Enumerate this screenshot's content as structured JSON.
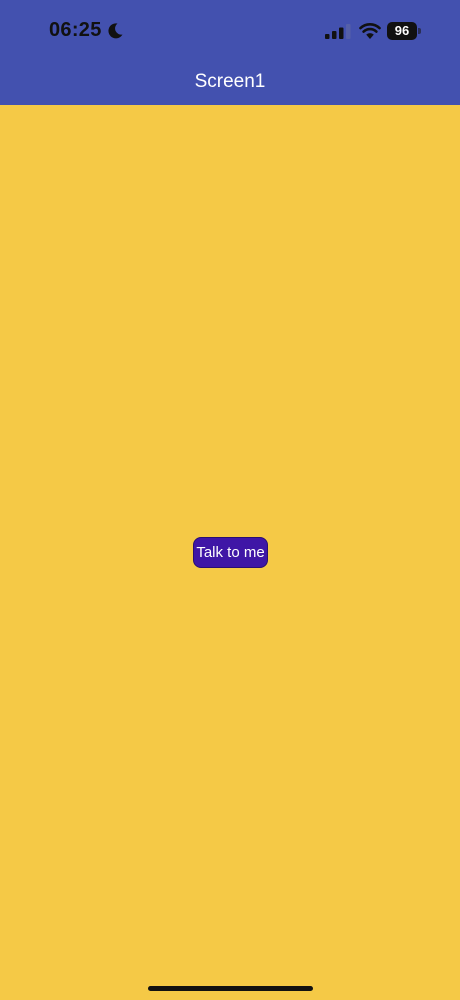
{
  "status_bar": {
    "time": "06:25",
    "battery_level": "96",
    "signal_bars_filled": 3,
    "signal_bars_total": 4,
    "icons": [
      "moon-icon",
      "cellular-signal-icon",
      "wifi-icon",
      "battery-icon"
    ]
  },
  "header": {
    "title": "Screen1"
  },
  "main": {
    "button_label": "Talk to me"
  },
  "colors": {
    "header_background": "#4351AF",
    "screen_background": "#F5C946",
    "button_background": "#3F16A6",
    "button_text": "#FFFFFF",
    "title_text": "#FFFFFF"
  }
}
